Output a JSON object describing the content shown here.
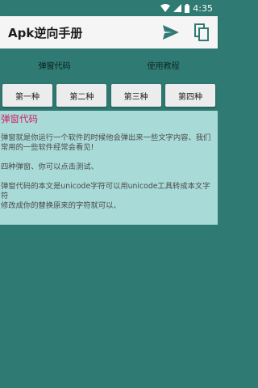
{
  "status_bar": {
    "time": "4:35",
    "icons": [
      "wifi-icon",
      "cellular-signal-icon",
      "battery-icon"
    ]
  },
  "app_bar": {
    "title": "Apk逆向手册",
    "actions": [
      "send-icon",
      "copy-icon"
    ]
  },
  "tabs": [
    {
      "label": "弹窗代码",
      "active": true
    },
    {
      "label": "使用教程",
      "active": false
    }
  ],
  "buttons": [
    {
      "label": "第一种"
    },
    {
      "label": "第二种"
    },
    {
      "label": "第三种"
    },
    {
      "label": "第四种"
    }
  ],
  "content": {
    "title": "弹窗代码",
    "para1": "弹窗就是你运行一个软件的时候他会弹出来一些文字内容、我们常用的一些软件经常会看见!",
    "para2": "四种弹窗、你可以点击测试、",
    "para3a": "弹窗代码的本文是unicode字符可以用unicode工具转成本文字符",
    "para3b": "修改成你的替换原来的字符就可以、"
  },
  "colors": {
    "primary": "#2f7a72",
    "content_bg": "#a8dad7",
    "accent_title": "#d0206b",
    "app_bar_bg": "#f5f5f5"
  }
}
